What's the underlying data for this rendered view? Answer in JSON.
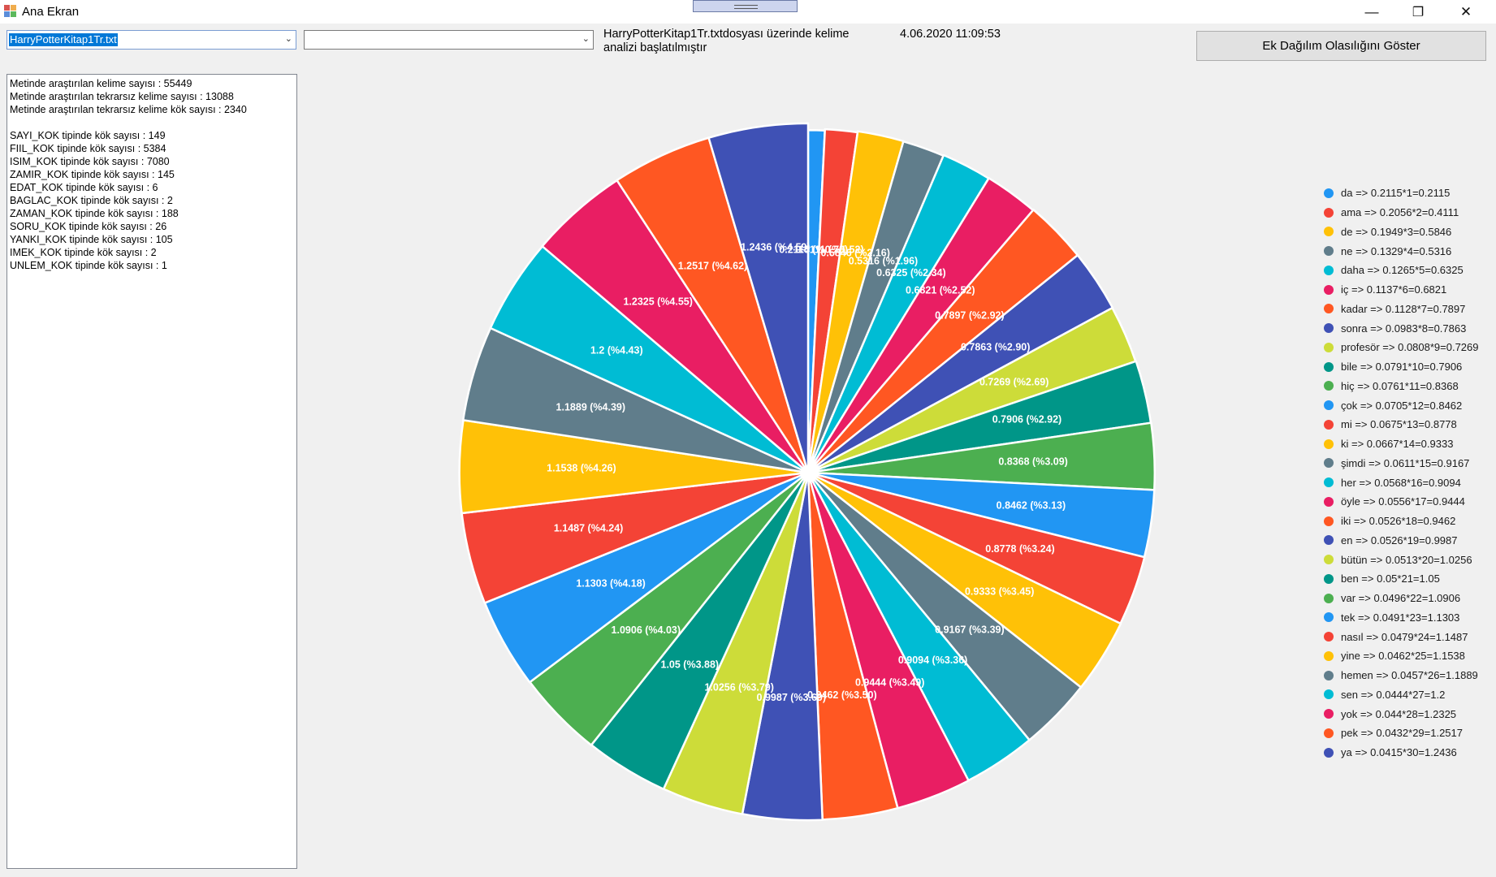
{
  "window": {
    "title": "Ana Ekran",
    "minimize_glyph": "—",
    "maximize_glyph": "❐",
    "close_glyph": "✕"
  },
  "file_select": {
    "value": "HarryPotterKitap1Tr.txt"
  },
  "second_select": {
    "value": ""
  },
  "status": {
    "message": "HarryPotterKitap1Tr.txtdosyası üzerinde kelime analizi başlatılmıştır",
    "timestamp": "4.06.2020 11:09:53"
  },
  "show_distribution_button": "Ek Dağılım Olasılığını Göster",
  "stats_text": "Metinde araştırılan kelime sayısı : 55449\nMetinde araştırılan tekrarsız kelime sayısı : 13088\nMetinde araştırılan tekrarsız kelime kök sayısı : 2340\n\nSAYI_KOK tipinde kök sayısı : 149\nFIIL_KOK tipinde kök sayısı : 5384\nISIM_KOK tipinde kök sayısı : 7080\nZAMIR_KOK tipinde kök sayısı : 145\nEDAT_KOK tipinde kök sayısı : 6\nBAGLAC_KOK tipinde kök sayısı : 2\nZAMAN_KOK tipinde kök sayısı : 188\nSORU_KOK tipinde kök sayısı : 26\nYANKI_KOK tipinde kök sayısı : 105\nIMEK_KOK tipinde kök sayısı : 2\nUNLEM_KOK tipinde kök sayısı : 1",
  "chart_data": {
    "type": "pie",
    "title": "",
    "legend_position": "right",
    "slices": [
      {
        "value": 0.2115,
        "label": "0.2115 (%0.78)",
        "legend": "da => 0.2115*1=0.2115",
        "color": "#2196f3"
      },
      {
        "value": 0.4111,
        "label": "0.4111 (%1.52)",
        "legend": "ama => 0.2056*2=0.4111",
        "color": "#f44336"
      },
      {
        "value": 0.5846,
        "label": "0.5846 (%2.16)",
        "legend": "de => 0.1949*3=0.5846",
        "color": "#ffc107"
      },
      {
        "value": 0.5316,
        "label": "0.5316 (%1.96)",
        "legend": "ne => 0.1329*4=0.5316",
        "color": "#607d8b"
      },
      {
        "value": 0.6325,
        "label": "0.6325 (%2.34)",
        "legend": "daha => 0.1265*5=0.6325",
        "color": "#00bcd4"
      },
      {
        "value": 0.6821,
        "label": "0.6821 (%2.52)",
        "legend": "iç => 0.1137*6=0.6821",
        "color": "#e91e63"
      },
      {
        "value": 0.7897,
        "label": "0.7897 (%2.92)",
        "legend": "kadar => 0.1128*7=0.7897",
        "color": "#ff5722"
      },
      {
        "value": 0.7863,
        "label": "0.7863 (%2.90)",
        "legend": "sonra => 0.0983*8=0.7863",
        "color": "#3f51b5"
      },
      {
        "value": 0.7269,
        "label": "0.7269 (%2.69)",
        "legend": "profesör => 0.0808*9=0.7269",
        "color": "#cddc39"
      },
      {
        "value": 0.7906,
        "label": "0.7906 (%2.92)",
        "legend": "bile => 0.0791*10=0.7906",
        "color": "#009688"
      },
      {
        "value": 0.8368,
        "label": "0.8368 (%3.09)",
        "legend": "hiç => 0.0761*11=0.8368",
        "color": "#4caf50"
      },
      {
        "value": 0.8462,
        "label": "0.8462 (%3.13)",
        "legend": "çok => 0.0705*12=0.8462",
        "color": "#2196f3"
      },
      {
        "value": 0.8778,
        "label": "0.8778 (%3.24)",
        "legend": "mi => 0.0675*13=0.8778",
        "color": "#f44336"
      },
      {
        "value": 0.9333,
        "label": "0.9333 (%3.45)",
        "legend": "ki => 0.0667*14=0.9333",
        "color": "#ffc107"
      },
      {
        "value": 0.9167,
        "label": "0.9167 (%3.39)",
        "legend": "şimdi => 0.0611*15=0.9167",
        "color": "#607d8b"
      },
      {
        "value": 0.9094,
        "label": "0.9094 (%3.36)",
        "legend": "her => 0.0568*16=0.9094",
        "color": "#00bcd4"
      },
      {
        "value": 0.9444,
        "label": "0.9444 (%3.49)",
        "legend": "öyle => 0.0556*17=0.9444",
        "color": "#e91e63"
      },
      {
        "value": 0.9462,
        "label": "0.9462 (%3.50)",
        "legend": "iki => 0.0526*18=0.9462",
        "color": "#ff5722"
      },
      {
        "value": 0.9987,
        "label": "0.9987 (%3.69)",
        "legend": "en => 0.0526*19=0.9987",
        "color": "#3f51b5"
      },
      {
        "value": 1.0256,
        "label": "1.0256 (%3.79)",
        "legend": "bütün => 0.0513*20=1.0256",
        "color": "#cddc39"
      },
      {
        "value": 1.05,
        "label": "1.05 (%3.88)",
        "legend": "ben => 0.05*21=1.05",
        "color": "#009688"
      },
      {
        "value": 1.0906,
        "label": "1.0906 (%4.03)",
        "legend": "var => 0.0496*22=1.0906",
        "color": "#4caf50"
      },
      {
        "value": 1.1303,
        "label": "1.1303 (%4.18)",
        "legend": "tek => 0.0491*23=1.1303",
        "color": "#2196f3"
      },
      {
        "value": 1.1487,
        "label": "1.1487 (%4.24)",
        "legend": "nasıl => 0.0479*24=1.1487",
        "color": "#f44336"
      },
      {
        "value": 1.1538,
        "label": "1.1538 (%4.26)",
        "legend": "yine => 0.0462*25=1.1538",
        "color": "#ffc107"
      },
      {
        "value": 1.1889,
        "label": "1.1889 (%4.39)",
        "legend": "hemen => 0.0457*26=1.1889",
        "color": "#607d8b"
      },
      {
        "value": 1.2,
        "label": "1.2 (%4.43)",
        "legend": "sen => 0.0444*27=1.2",
        "color": "#00bcd4"
      },
      {
        "value": 1.2325,
        "label": "1.2325 (%4.55)",
        "legend": "yok => 0.044*28=1.2325",
        "color": "#e91e63"
      },
      {
        "value": 1.2517,
        "label": "1.2517 (%4.62)",
        "legend": "pek => 0.0432*29=1.2517",
        "color": "#ff5722"
      },
      {
        "value": 1.2436,
        "label": "1.2436 (%4.59)",
        "legend": "ya => 0.0415*30=1.2436",
        "color": "#3f51b5"
      }
    ]
  }
}
